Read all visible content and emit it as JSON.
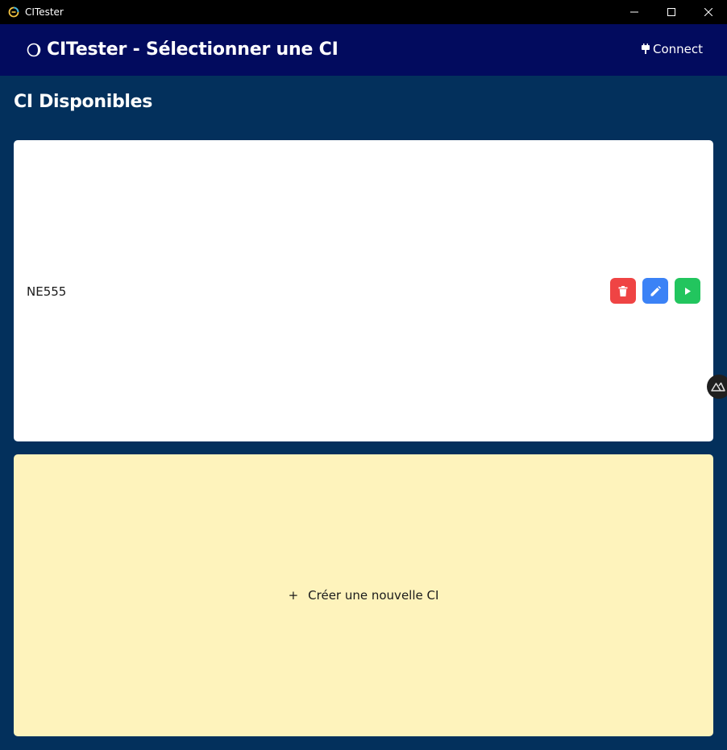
{
  "window": {
    "title": "CITester"
  },
  "header": {
    "title": "CITester - Sélectionner une CI",
    "connect_label": "Connect"
  },
  "page": {
    "heading": "CI Disponibles"
  },
  "ci_list": [
    {
      "name": "NE555",
      "actions": [
        "delete",
        "edit",
        "run"
      ]
    }
  ],
  "create_card": {
    "icon": "+",
    "label": "Créer une nouvelle CI"
  },
  "colors": {
    "titlebar": "#000000",
    "header": "#020b5e",
    "background": "#03305c",
    "delete": "#ef4444",
    "edit": "#3b82f6",
    "run": "#22c55e",
    "create_card": "#fef3bc"
  }
}
